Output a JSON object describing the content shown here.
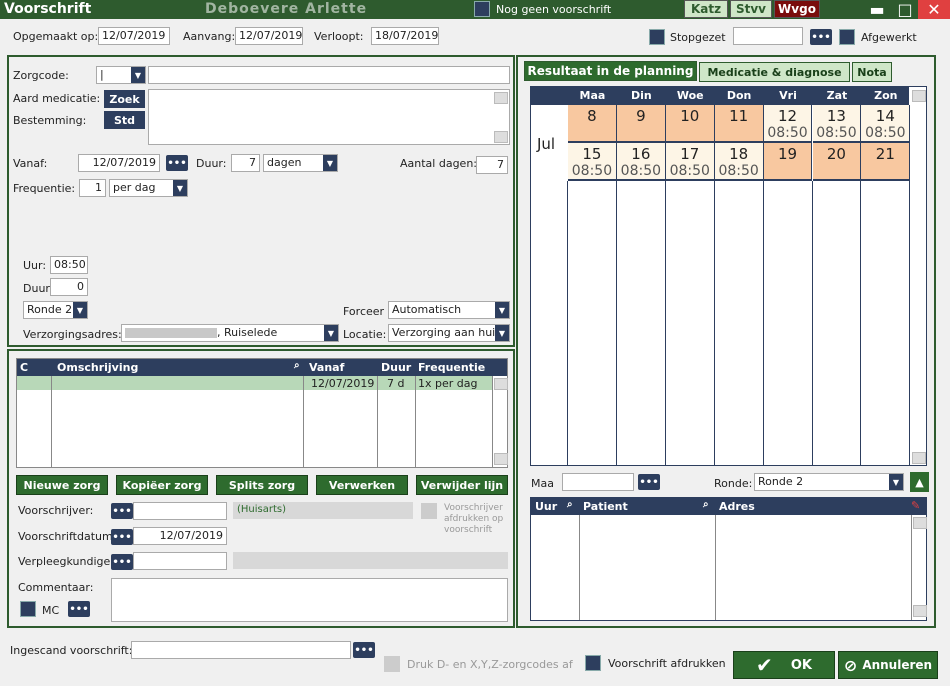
{
  "window": {
    "title": "Voorschrift",
    "patient_name": "Deboevere Arlette",
    "nog_geen": "Nog geen voorschrift",
    "btn_katz": "Katz",
    "btn_stvv": "Stvv",
    "btn_wvgo": "Wvgo",
    "minimize": "▬",
    "maximize": "□",
    "close": "✕"
  },
  "top": {
    "opgemaakt_label": "Opgemaakt op:",
    "opgemaakt_val": "12/07/2019",
    "aanvang_label": "Aanvang:",
    "aanvang_val": "12/07/2019",
    "verloopt_label": "Verloopt:",
    "verloopt_val": "18/07/2019",
    "stopgezet_label": "Stopgezet",
    "stopgezet_val": "",
    "afgewerkt_label": "Afgewerkt"
  },
  "form": {
    "zorgcode_label": "Zorgcode:",
    "zorgcode_val": "|",
    "aard_label": "Aard medicatie:",
    "zoek_btn": "Zoek",
    "bestemming_label": "Bestemming:",
    "std_btn": "Std",
    "vanaf_label": "Vanaf:",
    "vanaf_val": "12/07/2019",
    "duur_label": "Duur:",
    "duur_val": "7",
    "duur_unit": "dagen",
    "aantal_label": "Aantal dagen:",
    "aantal_val": "7",
    "freq_label": "Frequentie:",
    "freq_val": "1",
    "freq_unit": "per dag",
    "uur_label": "Uur:",
    "uur_val": "08:50",
    "duur2_label": "Duur",
    "duur2_val": "0",
    "ronde_val": "Ronde 2",
    "forceer_label": "Forceer",
    "forceer_val": "Automatisch",
    "adres_label": "Verzorgingsadres:",
    "adres_val": ", Ruiselede",
    "locatie_label": "Locatie:",
    "locatie_val": "Verzorging aan huis"
  },
  "table": {
    "headers": [
      "C",
      "Omschrijving",
      "Vanaf",
      "Duur",
      "Frequentie"
    ],
    "rows": [
      {
        "c": "",
        "omschrijving": "",
        "vanaf": "12/07/2019",
        "duur": "7 d",
        "frequentie": "1x per dag"
      }
    ]
  },
  "buttons": {
    "nieuwe": "Nieuwe zorg",
    "kopieer": "Kopiëer zorg",
    "splits": "Splits zorg",
    "verwerken": "Verwerken",
    "verwijder": "Verwijder lijn"
  },
  "bottom_form": {
    "voorschrijver_label": "Voorschrijver:",
    "voorschrijver_val": "",
    "huisarts": "(Huisarts)",
    "afdrukken_op": "Voorschrijver afdrukken op voorschrift",
    "vdatum_label": "Voorschriftdatum",
    "vdatum_val": "12/07/2019",
    "verpleeg_label": "Verpleegkundige:",
    "verpleeg_val": "",
    "commentaar_label": "Commentaar:",
    "mc_label": "MC"
  },
  "tabs": {
    "t1": "Resultaat in de planning",
    "t2": "Medicatie & diagnose",
    "t3": "Nota"
  },
  "calendar": {
    "month": "Jul",
    "days": [
      "Maa",
      "Din",
      "Woe",
      "Don",
      "Vri",
      "Zat",
      "Zon"
    ],
    "week1": [
      {
        "d": "8",
        "t": "",
        "c": "#f8c8a0"
      },
      {
        "d": "9",
        "t": "",
        "c": "#f8c8a0"
      },
      {
        "d": "10",
        "t": "",
        "c": "#f8c8a0"
      },
      {
        "d": "11",
        "t": "",
        "c": "#f8c8a0"
      },
      {
        "d": "12",
        "t": "08:50",
        "c": "#fdf5e6"
      },
      {
        "d": "13",
        "t": "08:50",
        "c": "#fdf5e6"
      },
      {
        "d": "14",
        "t": "08:50",
        "c": "#fdf5e6"
      }
    ],
    "week2": [
      {
        "d": "15",
        "t": "08:50",
        "c": "#fdf5e6"
      },
      {
        "d": "16",
        "t": "08:50",
        "c": "#fdf5e6"
      },
      {
        "d": "17",
        "t": "08:50",
        "c": "#fdf5e6"
      },
      {
        "d": "18",
        "t": "08:50",
        "c": "#fdf5e6"
      },
      {
        "d": "19",
        "t": "",
        "c": "#f8c8a0"
      },
      {
        "d": "20",
        "t": "",
        "c": "#f8c8a0"
      },
      {
        "d": "21",
        "t": "",
        "c": "#f8c8a0"
      }
    ]
  },
  "planning": {
    "maa_label": "Maa",
    "maa_val": "",
    "ronde_label": "Ronde:",
    "ronde_val": "Ronde 2",
    "headers": [
      "Uur",
      "Patient",
      "Adres"
    ]
  },
  "footer": {
    "ingescand_label": "Ingescand voorschrift:",
    "ingescand_val": "",
    "druk_label": "Druk D- en X,Y,Z-zorgcodes af",
    "afdrukken_label": "Voorschrift afdrukken",
    "ok": "OK",
    "annuleren": "Annuleren"
  },
  "colors": {
    "green": "#2e5b2e",
    "navy": "#2d3e5e",
    "peach": "#f8c8a0",
    "cream": "#fdf5e6",
    "selrow": "#b8d8b8"
  }
}
